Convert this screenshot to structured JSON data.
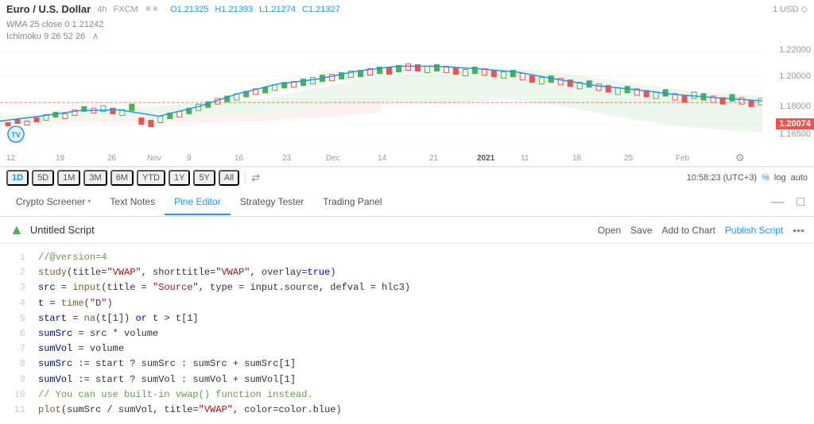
{
  "chart": {
    "title": "Euro / U.S. Dollar",
    "interval": "4h",
    "exchange": "FXCM",
    "price_o": "O1.21325",
    "price_h": "H1.21393",
    "price_l": "L1.21274",
    "price_c": "C1.21327",
    "usd_label": "1 USD ◇",
    "wma": "WMA 25 close 0  1.21242",
    "ichimoku": "Ichimoku 9 26 52 26",
    "current_price": "1.20074",
    "price_levels": [
      "1.22000",
      "1.20000",
      "1.18000",
      "1.16500"
    ],
    "time_labels": [
      "12",
      "19",
      "26",
      "Nov",
      "9",
      "16",
      "23",
      "Dec",
      "14",
      "21",
      "2021",
      "11",
      "18",
      "25",
      "Feb"
    ],
    "time_label_gear": "⚙"
  },
  "toolbar": {
    "periods": [
      "1D",
      "5D",
      "1M",
      "3M",
      "6M",
      "YTD",
      "1Y",
      "5Y",
      "All"
    ],
    "active_period": "1D",
    "compare_icon": "⇄",
    "time_display": "10:58:23 (UTC+3)",
    "pct_label": "%",
    "log_label": "log",
    "auto_label": "auto"
  },
  "tabs": {
    "items": [
      {
        "label": "Crypto Screener",
        "dropdown": true,
        "active": false
      },
      {
        "label": "Text Notes",
        "dropdown": false,
        "active": false
      },
      {
        "label": "Pine Editor",
        "dropdown": false,
        "active": true
      },
      {
        "label": "Strategy Tester",
        "dropdown": false,
        "active": false
      },
      {
        "label": "Trading Panel",
        "dropdown": false,
        "active": false
      }
    ],
    "minimize_icon": "—",
    "maximize_icon": "□"
  },
  "script": {
    "icon": "▲",
    "title": "Untitled Script",
    "actions": {
      "open": "Open",
      "save": "Save",
      "add_to_chart": "Add to Chart",
      "publish": "Publish Script",
      "more": "•••"
    }
  },
  "code": {
    "lines": [
      {
        "num": 1,
        "content": "//@version=4",
        "type": "comment"
      },
      {
        "num": 2,
        "content": "study(title=\"VWAP\", shorttitle=\"VWAP\", overlay=true)",
        "type": "mixed"
      },
      {
        "num": 3,
        "content": "src = input(title = \"Source\", type = input.source, defval = hlc3)",
        "type": "mixed"
      },
      {
        "num": 4,
        "content": "t = time(\"D\")",
        "type": "mixed"
      },
      {
        "num": 5,
        "content": "start = na(t[1]) or t > t[1]",
        "type": "mixed"
      },
      {
        "num": 6,
        "content": "sumSrc = src * volume",
        "type": "code"
      },
      {
        "num": 7,
        "content": "sumVol = volume",
        "type": "code"
      },
      {
        "num": 8,
        "content": "sumSrc := start ? sumSrc : sumSrc + sumSrc[1]",
        "type": "mixed"
      },
      {
        "num": 9,
        "content": "sumVol := start ? sumVol : sumVol + sumVol[1]",
        "type": "mixed"
      },
      {
        "num": 10,
        "content": "// You can use built-in vwap() function instead.",
        "type": "comment"
      },
      {
        "num": 11,
        "content": "plot(sumSrc / sumVol, title=\"VWAP\", color=color.blue)",
        "type": "mixed"
      }
    ]
  }
}
